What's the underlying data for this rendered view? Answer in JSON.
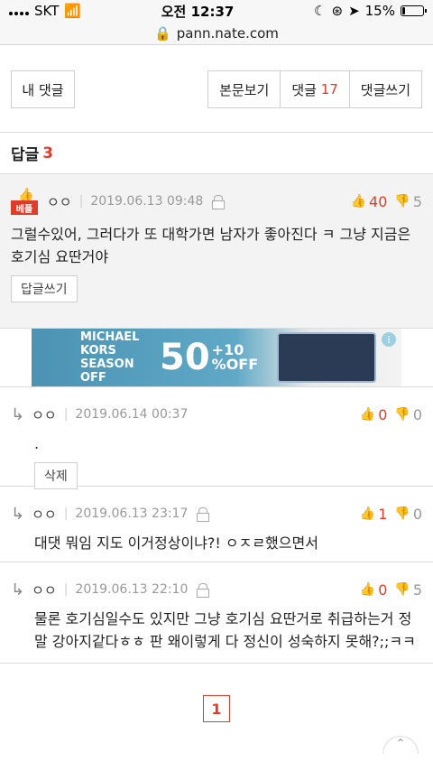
{
  "status_bar": {
    "carrier": "SKT",
    "time": "오전 12:37",
    "battery": "15%",
    "battery_level": 0.15
  },
  "url_bar": {
    "domain": "pann.nate.com"
  },
  "top_buttons": {
    "my_comments": "내 댓글",
    "view_article": "본문보기",
    "comments_label": "댓글",
    "comments_count": "17",
    "write_comment": "댓글쓰기"
  },
  "reply_header": {
    "label": "답글",
    "count": "3"
  },
  "best_comment": {
    "badge": "베플",
    "author": "ㅇㅇ",
    "date": "2019.06.13 09:48",
    "up": "40",
    "down": "5",
    "body": "그럴수있어, 그러다가 또 대학가면 남자가 좋아진다 ㅋ 그냥 지금은 호기심 요딴거야",
    "reply_button": "답글쓰기"
  },
  "ad": {
    "brand": "MICHAEL KORS SEASON OFF",
    "big": "50",
    "plus": "+10",
    "off": "%OFF",
    "info": "i"
  },
  "replies": [
    {
      "author": "ㅇㅇ",
      "date": "2019.06.14 00:37",
      "up": "0",
      "down": "0",
      "body": ".",
      "delete_button": "삭제"
    },
    {
      "author": "ㅇㅇ",
      "date": "2019.06.13 23:17",
      "up": "1",
      "down": "0",
      "body": "대댓 뭐임 지도 이거정상이냐?! ㅇㅈㄹ했으면서"
    },
    {
      "author": "ㅇㅇ",
      "date": "2019.06.13 22:10",
      "up": "0",
      "down": "5",
      "body": "물론 호기심일수도 있지만 그냥 호기심 요딴거로 취급하는거 정말 강아지같다ㅎㅎ 판 왜이렇게 다 정신이 성숙하지 못해?;;ㅋㅋ"
    }
  ],
  "pagination": {
    "current": "1"
  }
}
